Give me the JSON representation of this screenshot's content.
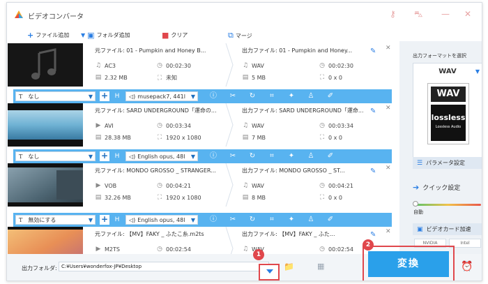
{
  "window": {
    "title": "ビデオコンバータ"
  },
  "toolbar": {
    "add_file": "ファイル追加",
    "add_folder": "フォルダ追加",
    "clear": "クリア",
    "merge": "マージ"
  },
  "files": [
    {
      "source_label": "元ファイル: 01 - Pumpkin and Honey B...",
      "output_label": "出力ファイル: 01 - Pumpkin and Honey...",
      "src_format": "AC3",
      "src_duration": "00:02:30",
      "src_size": "2.32 MB",
      "src_resolution": "未知",
      "out_format": "WAV",
      "out_duration": "00:02:30",
      "out_size": "5 MB",
      "out_resolution": "0 x 0"
    },
    {
      "source_label": "元ファイル: SARD UNDERGROUND「運命の...",
      "output_label": "出力ファイル: SARD UNDERGROUND「運命...",
      "src_format": "AVI",
      "src_duration": "00:03:34",
      "src_size": "28.38 MB",
      "src_resolution": "1920 x 1080",
      "out_format": "WAV",
      "out_duration": "00:03:34",
      "out_size": "7 MB",
      "out_resolution": "0 x 0"
    },
    {
      "source_label": "元ファイル: MONDO GROSSO _ STRANGER...",
      "output_label": "出力ファイル: MONDO GROSSO _ ST...",
      "src_format": "VOB",
      "src_duration": "00:04:21",
      "src_size": "32.26 MB",
      "src_resolution": "1920 x 1080",
      "out_format": "WAV",
      "out_duration": "00:04:21",
      "out_size": "8 MB",
      "out_resolution": "0 x 0"
    },
    {
      "source_label": "元ファイル: 【MV】FAKY _ ふたこ糸.m2ts",
      "output_label": "出力ファイル: 【MV】FAKY _ ふた...",
      "src_format": "M2TS",
      "src_duration": "00:02:54",
      "out_format": "WAV",
      "out_duration": "00:02:54"
    }
  ],
  "option_bars": [
    {
      "subtitle": "なし",
      "audio": "musepack7, 441l"
    },
    {
      "subtitle": "なし",
      "audio": "English opus, 48l"
    },
    {
      "subtitle": "無効にする",
      "audio": "English opus, 48l"
    }
  ],
  "sidebar": {
    "label": "出力フォーマットを選択",
    "format": "WAV",
    "format_icon_text": "WAV",
    "lossless_text": "lossless",
    "lossless_sub": "Lossless Audio",
    "param_settings": "パラメータ設定",
    "quick_settings": "クイック設定",
    "auto_label": "自動",
    "gpu_accel": "ビデオカード加速",
    "vendors": [
      "NVIDIA",
      "Intel"
    ]
  },
  "bottom": {
    "output_folder_label": "出力フォルダ:",
    "output_path": "C:¥Users¥wonderfox-JP¥Desktop",
    "convert_label": "変換",
    "badge_1": "1",
    "badge_2": "2"
  },
  "colors": {
    "accent": "#2aa0ea",
    "option_bar": "#58b3f0",
    "highlight": "#e0474c"
  }
}
